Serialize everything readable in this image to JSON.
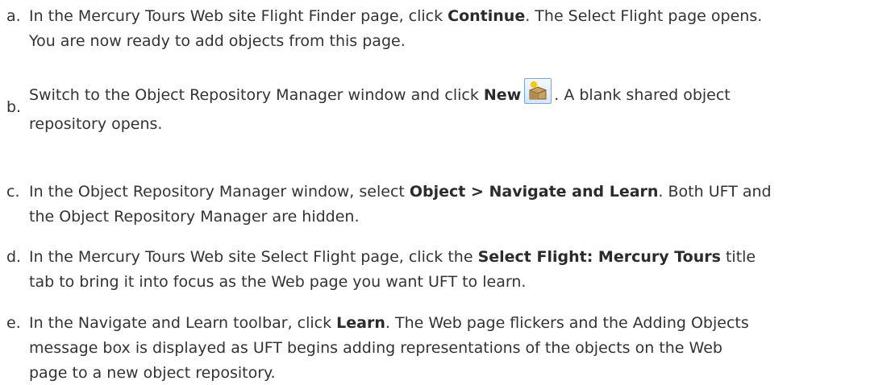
{
  "steps": [
    {
      "marker": "a.",
      "lines": [
        {
          "t1": "In the Mercury Tours Web site Flight Finder page, click ",
          "b1": "Continue",
          "t2": ". The Select Flight page opens."
        },
        {
          "text": "You are now ready to add objects from this page."
        }
      ]
    },
    {
      "marker": "b.",
      "lines": [
        {
          "t1": "Switch to the Object Repository Manager window and click ",
          "b1": "New",
          "icon": "new-repository-icon",
          "t2": ". A blank shared object"
        },
        {
          "text": "repository opens."
        }
      ]
    },
    {
      "marker": "c.",
      "lines": [
        {
          "t1": "In the Object Repository Manager window, select ",
          "b1": "Object > Navigate and Learn",
          "t2": ". Both UFT and"
        },
        {
          "text": "the Object Repository Manager are hidden."
        }
      ]
    },
    {
      "marker": "d.",
      "lines": [
        {
          "t1": "In the Mercury Tours Web site Select Flight page, click the ",
          "b1": "Select Flight: Mercury Tours",
          "t2": " title"
        },
        {
          "text": "tab to bring it into focus as the Web page you want UFT to learn."
        }
      ]
    },
    {
      "marker": "e.",
      "lines": [
        {
          "t1": "In the Navigate and Learn toolbar, click ",
          "b1": "Learn",
          "t2": ". The Web page flickers and the Adding Objects"
        },
        {
          "text": "message box is displayed as UFT begins adding representations of the objects on the Web"
        },
        {
          "text": "page to a new object repository."
        }
      ]
    }
  ]
}
